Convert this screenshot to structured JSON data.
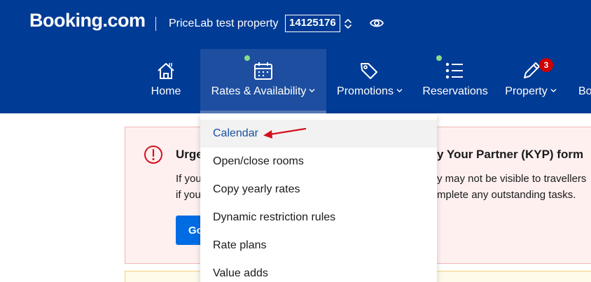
{
  "header": {
    "brand": "Booking.com",
    "property_name": "PriceLab test property",
    "property_id": "14125176",
    "icons": {
      "switcher": "chevron-updown-icon",
      "preview": "eye-icon"
    }
  },
  "nav": {
    "items": [
      {
        "label": "Home",
        "icon": "home-icon"
      },
      {
        "label": "Rates & Availability",
        "icon": "calendar-icon",
        "active": true,
        "has_dot": true
      },
      {
        "label": "Promotions",
        "icon": "tag-icon"
      },
      {
        "label": "Reservations",
        "icon": "list-icon",
        "has_dot": true
      },
      {
        "label": "Property",
        "icon": "pencil-icon",
        "badge": "3"
      },
      {
        "label": "Bo"
      }
    ]
  },
  "alert": {
    "title_left": "Urge",
    "title_right": "y Your Partner (KYP) form",
    "line1_left": "If you",
    "line1_right": "y may not be visible to travellers",
    "line2_left": "if you",
    "line2_right": "mplete any outstanding tasks.",
    "button_label": "Go"
  },
  "dropdown": {
    "items": [
      "Calendar",
      "Open/close rooms",
      "Copy yearly rates",
      "Dynamic restriction rules",
      "Rate plans",
      "Value adds"
    ],
    "highlighted": "Calendar"
  },
  "colors": {
    "header_bg": "#003b95",
    "active_tab_bg": "#1d4ea0",
    "notification_dot": "#86dc8a",
    "badge": "#cc0000",
    "alert_bg": "#fff0f0",
    "alert_icon": "#d4111e",
    "primary_button": "#006ce4",
    "annotation_arrow": "#d4111e"
  }
}
